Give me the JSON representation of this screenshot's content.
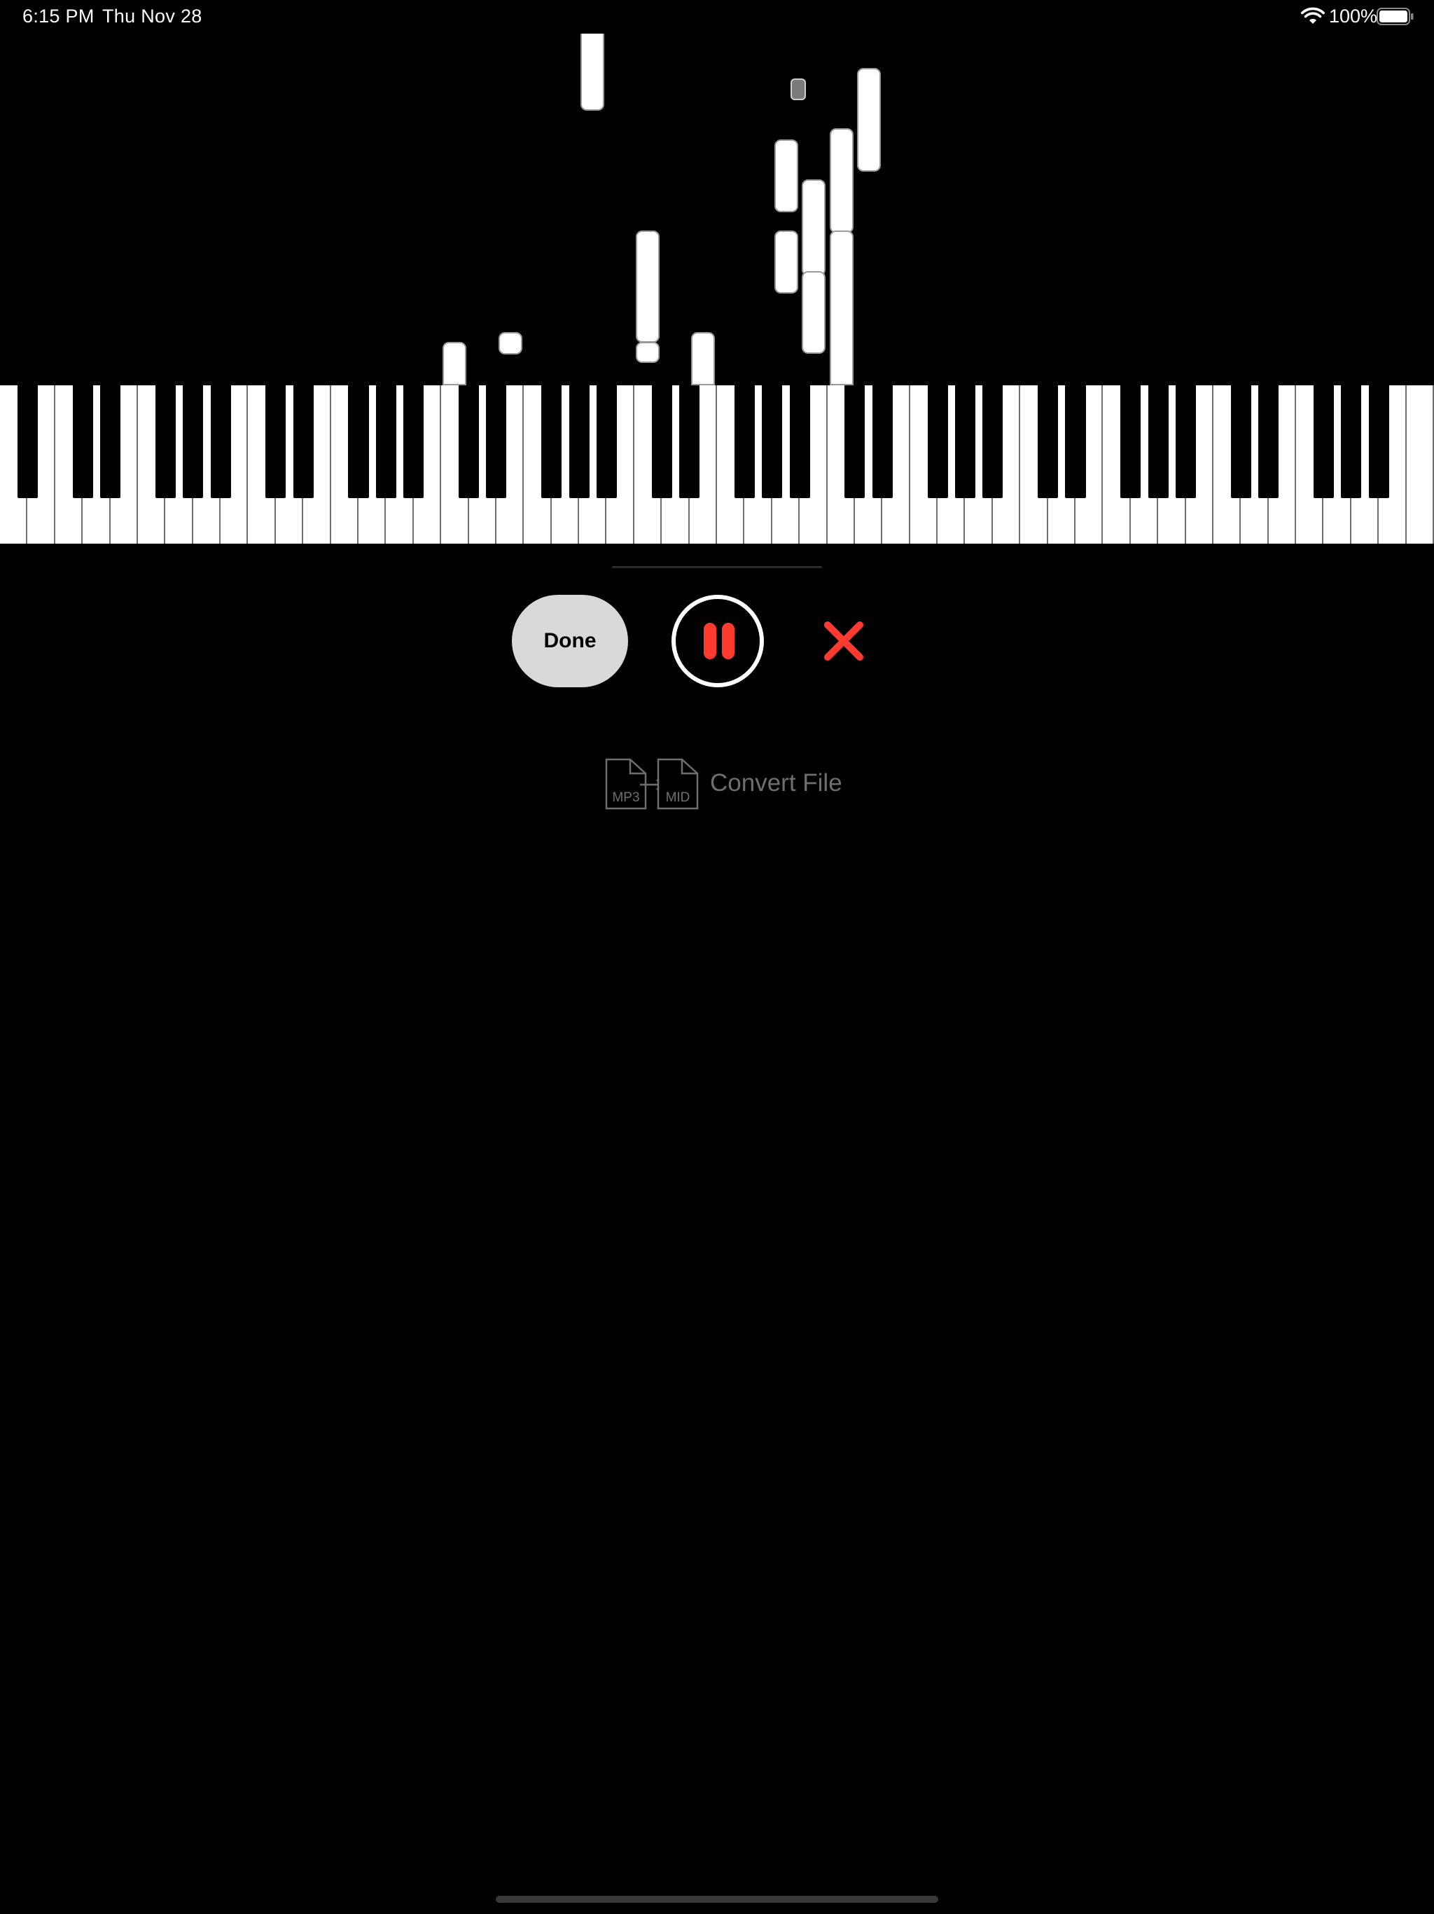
{
  "status_bar": {
    "time": "6:15 PM",
    "date": "Thu Nov 28",
    "battery_percent": "100%",
    "icons": [
      "wifi-icon",
      "battery-icon"
    ]
  },
  "controls": {
    "done_label": "Done",
    "pause_icon": "pause-icon",
    "cancel_icon": "close-icon",
    "accent_color": "#ff3b30"
  },
  "convert": {
    "label": "Convert File",
    "from_format": "MP3",
    "to_format": "MID"
  },
  "keyboard": {
    "white_key_count": 52
  }
}
